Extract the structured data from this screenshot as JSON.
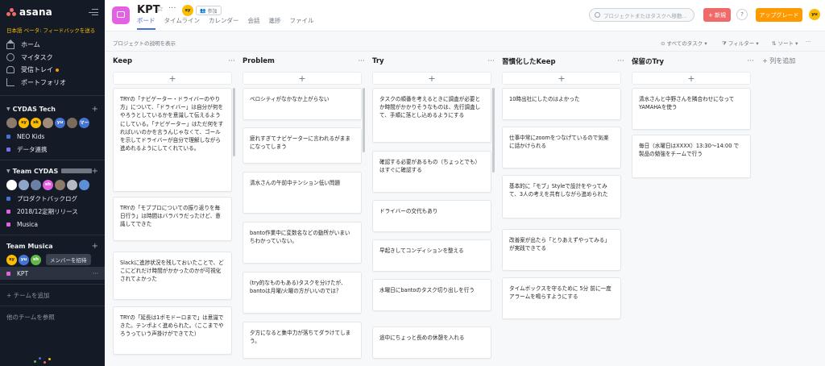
{
  "sidebar": {
    "logo": "asana",
    "beta": "日本語 ベータ: フィードバックを送る",
    "nav": [
      {
        "label": "ホーム",
        "icon": "home-icon"
      },
      {
        "label": "マイタスク",
        "icon": "check-circle-icon"
      },
      {
        "label": "受信トレイ",
        "icon": "bell-icon"
      },
      {
        "label": "ポートフォリオ",
        "icon": "bar-chart-icon"
      }
    ],
    "teams": [
      {
        "name": "CYDAS Tech",
        "avatars": [
          "",
          "sy",
          "sk",
          "",
          "yu",
          "",
          "マー"
        ],
        "projects": [
          {
            "label": "NEO Kids",
            "color": "#4573d2"
          },
          {
            "label": "データ連携",
            "color": "#7a6ff0"
          }
        ]
      },
      {
        "name": "Team CYDAS",
        "avatars": [
          "",
          "",
          "",
          "sh",
          "",
          "",
          ""
        ],
        "projects": [
          {
            "label": "プロダクトバックログ",
            "color": "#4573d2"
          },
          {
            "label": "2018/12定期リリース",
            "color": "#e362e3"
          },
          {
            "label": "Musica",
            "color": "#e362e3"
          }
        ]
      },
      {
        "name": "Team Musica",
        "avatars": [
          "sy",
          "yu",
          "sh"
        ],
        "invite": "メンバーを招待",
        "projects": [
          {
            "label": "KPT",
            "color": "#e362e3"
          }
        ]
      }
    ],
    "add_team": "+ チームを追加",
    "browse_teams": "他のチームを参照"
  },
  "header": {
    "title": "KPT",
    "join_avatar": "sy",
    "join_label": "参加",
    "tabs": [
      "ボード",
      "タイムライン",
      "カレンダー",
      "会話",
      "進捗",
      "ファイル"
    ],
    "search_placeholder": "プロジェクトまたはタスクへ移動...",
    "new_label": "+ 新規",
    "help_label": "?",
    "upgrade_label": "アップグレード",
    "user_avatar": "yu"
  },
  "subbar": {
    "desc_link": "プロジェクトの説明を表示",
    "all_tasks": "すべてのタスク",
    "filter": "フィルター",
    "sort": "ソート"
  },
  "board": {
    "add_column": "+ 列を追加",
    "columns": [
      {
        "title": "Keep",
        "cards": [
          "TRYの「ナビゲーター・ドライバーのやり方」について、「ドライバー」は自分が何をやろうとしているかを意識して伝えるようにしている。「ナビゲーター」はただ何をすればいいのかを言うんじゃなくて、ゴールを示してドライバーが自分で理解しながら進めれるようにしてくれている。",
          "TRYの「モブプロについての振り返りを毎日行う」は時間はバラバラだったけど、意識してできた",
          "Slackに進捗状況を残しておいたことで、どこにどれだけ時間がかかったのかが可視化されてよかった",
          "TRYの「延長は1ポモドーロまで」は意識できた。テンポよく進められた。（ここまでやろうっていう声掛けができてた）"
        ]
      },
      {
        "title": "Problem",
        "cards": [
          "ベロシティがなかなか上がらない",
          "疲れすぎてナビゲーターに言われるがままになってしまう",
          "清水さんの午前中テンション低い問題",
          "banto作業中に変数名などの動所がいまいちわかっていない。",
          "(try的なものもある)タスクを分けたが、bantoは月曜/火曜の方がいいのでは？",
          "夕方になると集中力が落ちてダラけてしまう。"
        ]
      },
      {
        "title": "Try",
        "cards": [
          "タスクの順番を考えるときに調査が必要とか時間がかかりそうなものは、先行調査して、手順に落とし込めるようにする",
          "確認する必要があるもの（ちょっとでも）はすぐに確認する",
          "ドライバーの交代もあり",
          "早起きしてコンディションを整える",
          "水曜日にbantoのタスク切り出しを行う",
          "途中にちょっと長めの休憩を入れる"
        ]
      },
      {
        "title": "習慣化したKeep",
        "cards": [
          "10時出社にしたのはよかった",
          "仕事中常にzoomをつなげているので気楽に話かけられる",
          "基本的に「モブ」Styleで設計をやってみて、3人の考えを共有しながら進められた",
          "改善案が出たら「とりあえずやってみる」が実践できてる",
          "タイムボックスを守るために 5分 前に一度アラームを鳴らすようにする"
        ]
      },
      {
        "title": "保留のTry",
        "cards": [
          "清水さんと中野さんを隣合わせになってYAMAHAを使う",
          "毎日（水曜日はXXXX）13:30～14:00 で製品の勉強をチームで行う"
        ]
      }
    ]
  },
  "colors": {
    "sidebar_bg": "#151b26",
    "accent_blue": "#4573d2",
    "new_button": "#f06a6a",
    "upgrade_button": "#fd9a00",
    "project_icon": "#e362e3"
  }
}
